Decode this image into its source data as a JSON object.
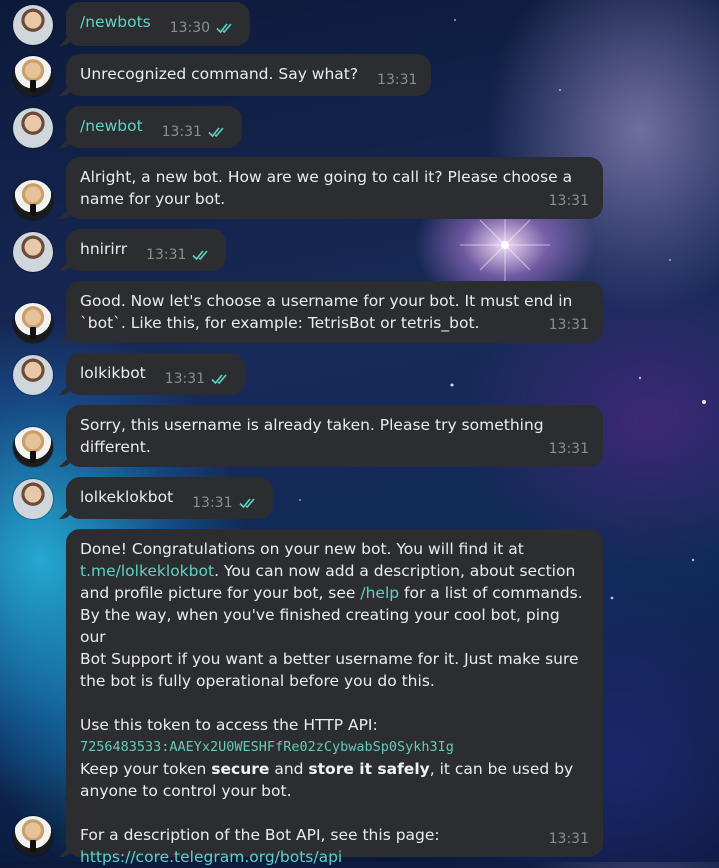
{
  "chat": {
    "messages": [
      {
        "sender": "user",
        "text": "/newbots",
        "time": "13:30",
        "is_command": true,
        "read": true
      },
      {
        "sender": "bot",
        "text": "Unrecognized command. Say what?",
        "time": "13:31"
      },
      {
        "sender": "user",
        "text": "/newbot",
        "time": "13:31",
        "is_command": true,
        "read": true
      },
      {
        "sender": "bot",
        "line1": "Alright, a new bot. How are we going to call it? Please choose a",
        "line2": "name for your bot.",
        "time": "13:31"
      },
      {
        "sender": "user",
        "text": "hnirirr",
        "time": "13:31",
        "read": true
      },
      {
        "sender": "bot",
        "line1": "Good. Now let's choose a username for your bot. It must end in",
        "line2": "`bot`. Like this, for example: TetrisBot or tetris_bot.",
        "time": "13:31"
      },
      {
        "sender": "user",
        "text": "lolkikbot",
        "time": "13:31",
        "read": true
      },
      {
        "sender": "bot",
        "line1": "Sorry, this username is already taken. Please try something",
        "line2": "different.",
        "time": "13:31"
      },
      {
        "sender": "user",
        "text": "lolkeklokbot",
        "time": "13:31",
        "read": true
      },
      {
        "sender": "bot",
        "time": "13:31",
        "p1_line1": "Done! Congratulations on your new bot. You will find it at",
        "p1_link": "t.me/lolkeklokbot",
        "p1_line2_rest": ". You can now add a description, about section",
        "p1_line3_start": "and profile picture for your bot, see ",
        "p1_help": "/help",
        "p1_line3_end": " for a list of commands.",
        "p1_line4": "By the way, when you've finished creating your cool bot, ping our",
        "p1_line5": "Bot Support if you want a better username for it. Just make sure",
        "p1_line6": "the bot is fully operational before you do this.",
        "p2_line1": "Use this token to access the HTTP API:",
        "token": "7256483533:AAEYx2U0WESHFfRe02zCybwabSp0Sykh3Ig",
        "p2_line3_start": "Keep your token ",
        "p2_bold1": "secure",
        "p2_mid": " and ",
        "p2_bold2": "store it safely",
        "p2_line3_end": ", it can be used by",
        "p2_line4": "anyone to control your bot.",
        "p3_line1": "For a description of the Bot API, see this page:",
        "p3_link": "https://core.telegram.org/bots/api"
      }
    ]
  },
  "icons": {
    "read_receipt": "double-check-icon"
  },
  "colors": {
    "bubble": "#2b2d31",
    "accent": "#5fd3c3",
    "time": "#8c8e93",
    "text": "#ececec"
  }
}
